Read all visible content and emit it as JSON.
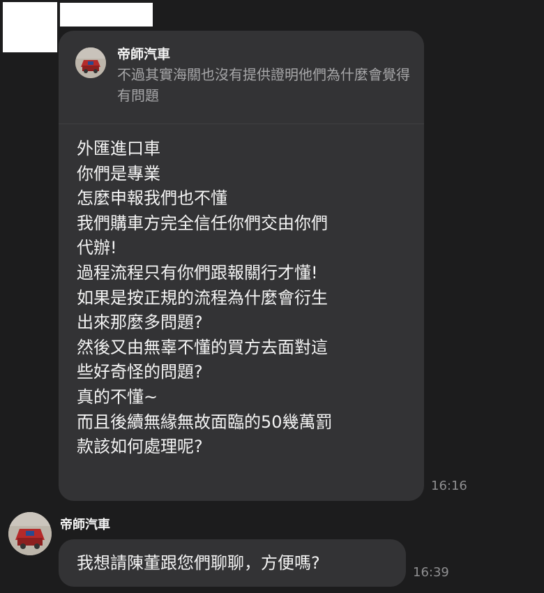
{
  "conversation": {
    "reply_preview": {
      "sender": "帝師汽車",
      "text": "不過其實海關也沒有提供證明他們為什麼會覺得有問題",
      "avatar_icon": "car-logo-avatar-icon"
    },
    "message_1": {
      "lines": [
        "外匯進口車",
        "你們是專業",
        "怎麼申報我們也不懂",
        "我們購車方完全信任你們交由你們",
        "代辦!",
        "過程流程只有你們跟報關行才懂!",
        "如果是按正規的流程為什麼會衍生",
        "出來那麼多問題?",
        "然後又由無辜不懂的買方去面對這",
        "些好奇怪的問題?",
        "真的不懂~",
        "而且後續無緣無故面臨的50幾萬罰",
        "款該如何處理呢?"
      ],
      "time": "16:16"
    },
    "message_2": {
      "sender": "帝師汽車",
      "text": "我想請陳董跟您們聊聊，方便嗎?",
      "time": "16:39",
      "avatar_icon": "car-logo-avatar-icon"
    }
  },
  "colors": {
    "background": "#1c1c1d",
    "bubble": "#333335",
    "primary_text": "#f4f4f4",
    "muted_text": "#a6a6a8",
    "timestamp": "#8f8f91"
  }
}
